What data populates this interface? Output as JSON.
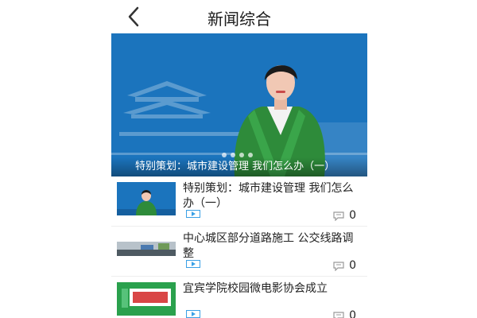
{
  "header": {
    "title": "新闻综合"
  },
  "hero": {
    "caption": "特别策划：城市建设管理  我们怎么办（一）",
    "dot_count": 4
  },
  "news": [
    {
      "title": "特别策划：城市建设管理  我们怎么办（一）",
      "comments": "0"
    },
    {
      "title": "中心城区部分道路施工  公交线路调整",
      "comments": "0"
    },
    {
      "title": "宜宾学院校园微电影协会成立",
      "comments": "0"
    }
  ],
  "colors": {
    "accent_blue": "#1f7dc2",
    "play_icon_blue": "#3aa0e6"
  },
  "icons": {
    "back": "chevron-left-icon",
    "play": "play-icon",
    "comment": "comment-icon"
  }
}
